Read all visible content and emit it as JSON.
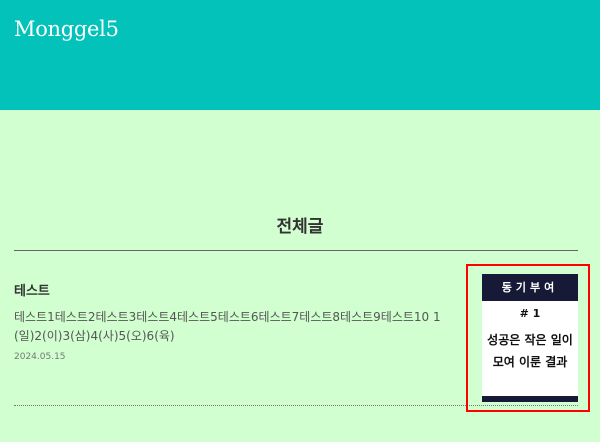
{
  "header": {
    "site_title": "Monggel5",
    "background": "#02c2b9"
  },
  "page": {
    "background": "#d1ffd0",
    "list_title": "전체글"
  },
  "posts": [
    {
      "title": "테스트",
      "excerpt": "테스트1테스트2테스트3테스트4테스트5테스트6테스트7테스트8테스트9테스트10 1(일)2(이)3(삼)4(사)5(오)6(육)",
      "date": "2024.05.15",
      "thumbnail": {
        "header": "동기부여",
        "number": "# 1",
        "line1": "성공은 작은 일이",
        "line2": "모여 이룬 결과",
        "highlight_color": "#ff0000",
        "band_color": "#161a36"
      }
    }
  ]
}
